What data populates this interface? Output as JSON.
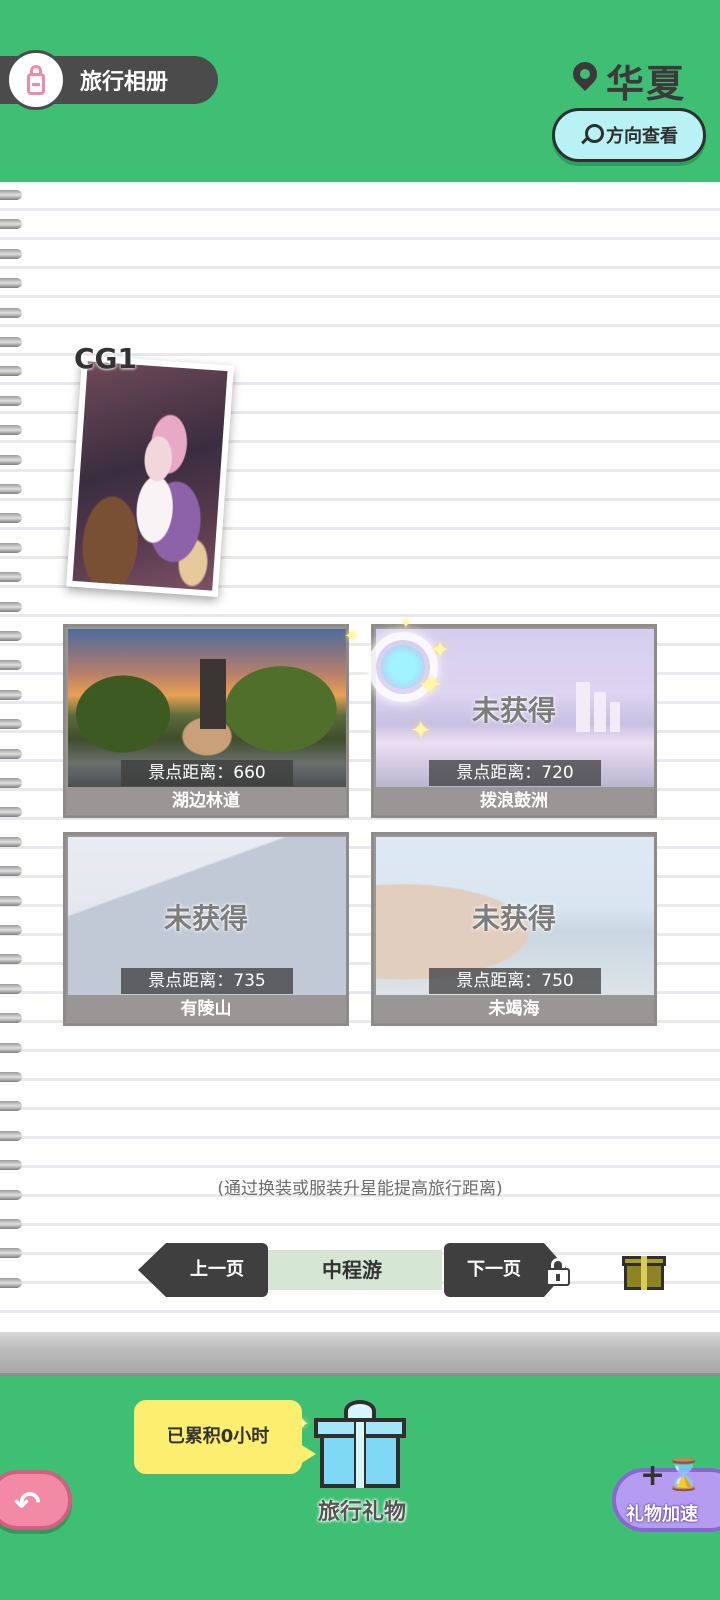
{
  "header": {
    "album_title": "旅行相册",
    "region_name": "华夏",
    "direction_button": "方向查看"
  },
  "cg": {
    "label": "CG1"
  },
  "spots": [
    {
      "name": "湖边林道",
      "distance_text": "景点距离：660",
      "locked": false,
      "locked_text": ""
    },
    {
      "name": "拨浪鼓洲",
      "distance_text": "景点距离：720",
      "locked": true,
      "locked_text": "未获得"
    },
    {
      "name": "有陵山",
      "distance_text": "景点距离：735",
      "locked": true,
      "locked_text": "未获得"
    },
    {
      "name": "未竭海",
      "distance_text": "景点距离：750",
      "locked": true,
      "locked_text": "未获得"
    }
  ],
  "hint": "(通过换装或服装升星能提高旅行距离)",
  "pager": {
    "prev_label": "上一页",
    "current_label": "中程游",
    "next_label": "下一页"
  },
  "bottom": {
    "accumulated_text": "已累积0小时",
    "gift_label": "旅行礼物",
    "speed_label": "礼物加速"
  },
  "icons": {
    "album": "lock-icon",
    "region": "location-pin-icon",
    "direction": "search-icon",
    "next_lock": "lock-icon",
    "gift_small": "gift-icon",
    "back": "back-arrow-icon",
    "big_gift": "gift-box-icon",
    "speed": "hourglass-plus-icon"
  },
  "colors": {
    "background_green": "#3fbf73",
    "dark_pill": "#4b4b4b",
    "direction_button": "#b8f2f4",
    "bubble_yellow": "#fcee6e",
    "back_pink": "#f28aa6",
    "speed_purple": "#b69cf0"
  }
}
